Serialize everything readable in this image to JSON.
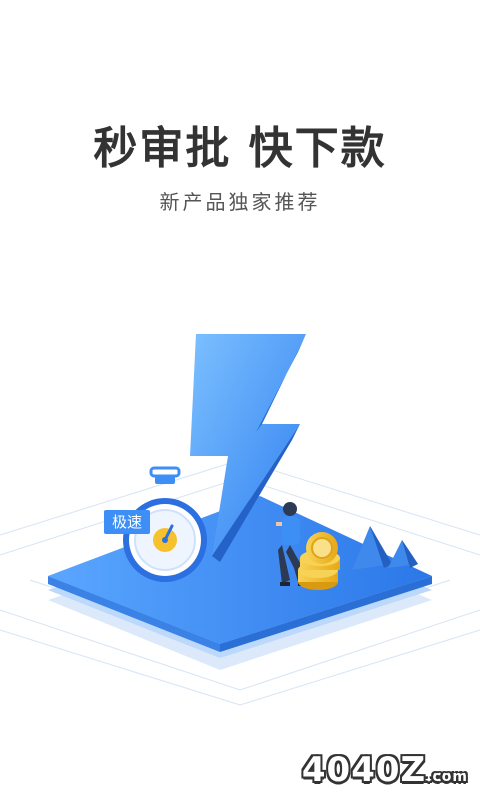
{
  "hero": {
    "title": "秒审批 快下款",
    "subtitle": "新产品独家推荐"
  },
  "illustration": {
    "badge_label": "极速",
    "accent_color": "#3d8ef5",
    "coin_color": "#f5c22e"
  },
  "watermark": {
    "brand": "4040Z",
    "suffix": ".com"
  }
}
